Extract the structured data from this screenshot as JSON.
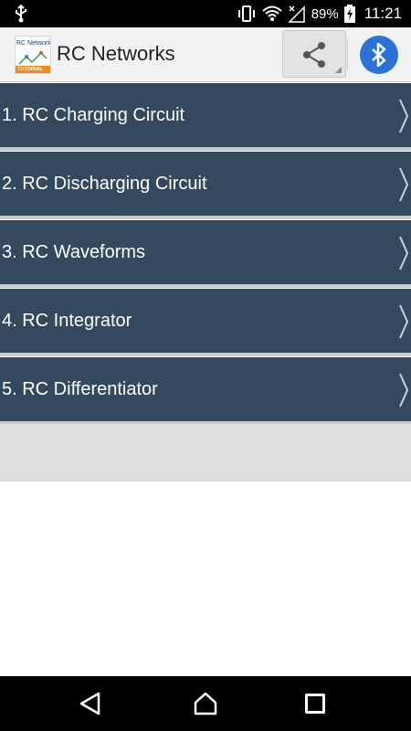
{
  "status_bar": {
    "battery": "89%",
    "time": "11:21",
    "icons": [
      "usb-icon",
      "vibrate-icon",
      "wifi-icon",
      "no-signal-icon",
      "battery-charging-icon"
    ]
  },
  "app_bar": {
    "logo_text": "RC Network",
    "logo_band": "TUTORIAL",
    "title": "RC Networks",
    "actions": [
      "share-icon",
      "bluetooth-icon"
    ]
  },
  "menu": {
    "items": [
      {
        "label": "1. RC Charging Circuit"
      },
      {
        "label": "2. RC Discharging Circuit"
      },
      {
        "label": "3. RC Waveforms"
      },
      {
        "label": "4. RC Integrator"
      },
      {
        "label": "5. RC Differentiator"
      }
    ]
  },
  "nav_bar": {
    "buttons": [
      "back-icon",
      "home-icon",
      "recents-icon"
    ]
  },
  "colors": {
    "list_bg": "#34495e",
    "accent_bluetooth": "#2a72d8",
    "status_bg": "#000000"
  }
}
